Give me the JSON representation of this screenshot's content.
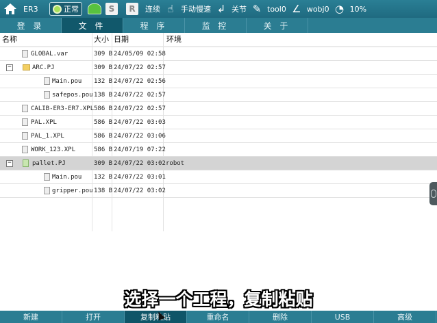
{
  "topbar": {
    "robot_name": "ER3",
    "status": "正常",
    "btn_s": "S",
    "btn_r": "R",
    "run_mode": "连续",
    "speed_mode": "手动慢速",
    "coord_mode": "关节",
    "tool": "tool0",
    "wobj": "wobj0",
    "speed_percent": "10%",
    "status_color": "#a8e05a"
  },
  "tabs": [
    {
      "label": "登 录"
    },
    {
      "label": "文 件"
    },
    {
      "label": "程 序"
    },
    {
      "label": "监 控"
    },
    {
      "label": "关 于"
    }
  ],
  "active_tab": "文 件",
  "columns": {
    "name": "名称",
    "size": "大小",
    "date": "日期",
    "env": "环境"
  },
  "rows": [
    {
      "toggle": "",
      "icon": "file-icon",
      "name": "GLOBAL.var",
      "size": "309 B",
      "date": "24/05/09 02:58",
      "env": ""
    },
    {
      "toggle": "−",
      "icon": "folder-icon",
      "name": "ARC.PJ",
      "size": "309 B",
      "date": "24/07/22 02:57",
      "env": ""
    },
    {
      "toggle": "",
      "icon": "file-icon",
      "name": "Main.pou",
      "size": "132 B",
      "date": "24/07/22 02:56",
      "env": ""
    },
    {
      "toggle": "",
      "icon": "file-icon",
      "name": "safepos.pou",
      "size": "138 B",
      "date": "24/07/22 02:57",
      "env": ""
    },
    {
      "toggle": "",
      "icon": "file-icon",
      "name": "CALIB-ER3-ER7.XPL",
      "size": "586 B",
      "date": "24/07/22 02:57",
      "env": ""
    },
    {
      "toggle": "",
      "icon": "file-icon",
      "name": "PAL.XPL",
      "size": "586 B",
      "date": "24/07/22 03:03",
      "env": ""
    },
    {
      "toggle": "",
      "icon": "file-icon",
      "name": "PAL_1.XPL",
      "size": "586 B",
      "date": "24/07/22 03:06",
      "env": ""
    },
    {
      "toggle": "",
      "icon": "file-icon",
      "name": "WORK_123.XPL",
      "size": "586 B",
      "date": "24/07/19 07:22",
      "env": ""
    },
    {
      "toggle": "−",
      "icon": "project-icon",
      "name": "pallet.PJ",
      "size": "309 B",
      "date": "24/07/22 03:02",
      "env": "robot"
    },
    {
      "toggle": "",
      "icon": "file-icon",
      "name": "Main.pou",
      "size": "132 B",
      "date": "24/07/22 03:01",
      "env": ""
    },
    {
      "toggle": "",
      "icon": "file-icon",
      "name": "gripper.pou",
      "size": "138 B",
      "date": "24/07/22 03:02",
      "env": ""
    }
  ],
  "subtitle": "选择一个工程，复制粘贴",
  "bottom_buttons": [
    {
      "label": "新建"
    },
    {
      "label": "打开"
    },
    {
      "label": "复制粘贴"
    },
    {
      "label": "重命名"
    },
    {
      "label": "删除"
    },
    {
      "label": "USB"
    },
    {
      "label": "高级"
    }
  ],
  "active_bottom": "复制粘贴",
  "accent_color": "#2b7d92",
  "selected_row_color": "#d4d4d4"
}
